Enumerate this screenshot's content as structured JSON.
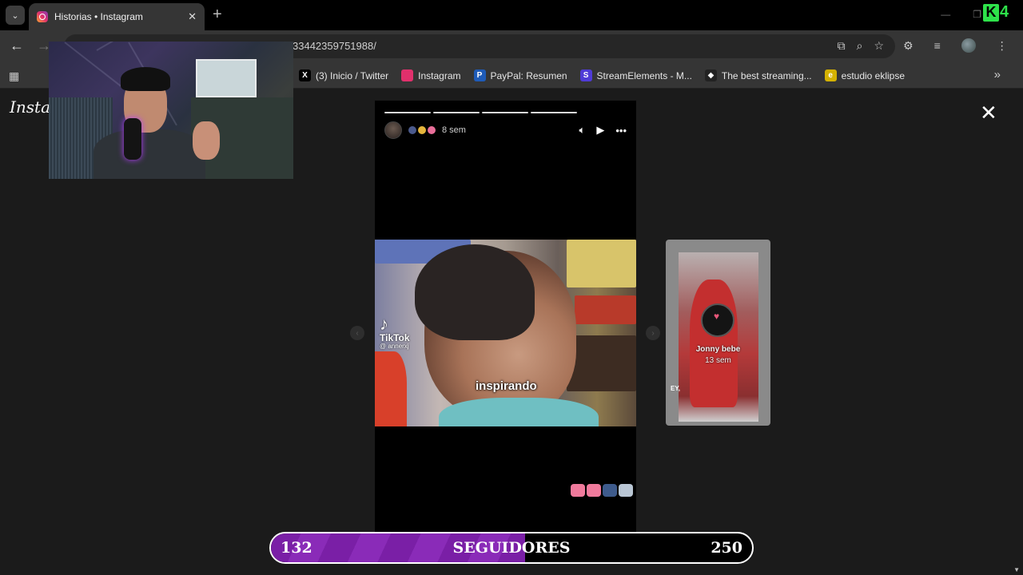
{
  "browser": {
    "tab": {
      "title": "Historias • Instagram",
      "close": "✕"
    },
    "new_tab": "+",
    "url_fragment": "33442359751988/",
    "bookmarks": [
      {
        "label": "(3) Inicio / Twitter",
        "icon": "x-twitter-icon",
        "glyph": "X",
        "color": "#000000"
      },
      {
        "label": "Instagram",
        "icon": "instagram-icon",
        "glyph": "",
        "color": "#e1306c"
      },
      {
        "label": "PayPal: Resumen",
        "icon": "paypal-icon",
        "glyph": "P",
        "color": "#1e5bb8"
      },
      {
        "label": "StreamElements - M...",
        "icon": "streamelements-icon",
        "glyph": "S",
        "color": "#4f3bd6"
      },
      {
        "label": "The best streaming...",
        "icon": "streaming-site-icon",
        "glyph": "◆",
        "color": "#222222"
      },
      {
        "label": "estudio eklipse",
        "icon": "eklipse-icon",
        "glyph": "e",
        "color": "#d4b200"
      }
    ]
  },
  "instagram": {
    "logo": "Instag",
    "story": {
      "time": "8 sem",
      "caption": "inspirando",
      "tiktok_label": "TikTok",
      "tiktok_user": "@ annerxj"
    },
    "next_story": {
      "name": "Jonny bebe",
      "time": "13 sem",
      "corner_text": "EY,"
    }
  },
  "overlay": {
    "followers": {
      "current": "132",
      "label": "SEGUIDORES",
      "goal": "250",
      "progress_fraction": 0.528,
      "fill_color": "#7a1fa6"
    },
    "brand": "4"
  }
}
